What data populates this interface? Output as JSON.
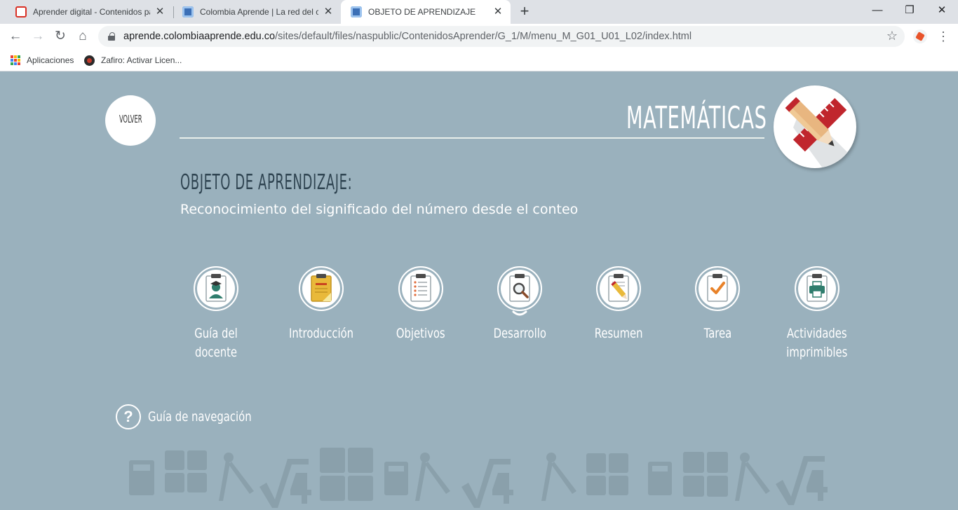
{
  "browser": {
    "tabs": [
      {
        "title": "Aprender digital - Contenidos pa",
        "active": false
      },
      {
        "title": "Colombia Aprende | La red del co",
        "active": false
      },
      {
        "title": "OBJETO DE APRENDIZAJE",
        "active": true
      }
    ],
    "new_tab_label": "+",
    "window_controls": {
      "minimize": "—",
      "restore": "❐",
      "close": "✕"
    },
    "url_host": "aprende.colombiaaprende.edu.co",
    "url_path": "/sites/default/files/naspublic/ContenidosAprender/G_1/M/menu_M_G01_U01_L02/index.html",
    "bookmarks": [
      {
        "label": "Aplicaciones",
        "icon": "apps-grid-icon"
      },
      {
        "label": "Zafiro: Activar Licen...",
        "icon": "zafiro-icon"
      }
    ]
  },
  "page": {
    "back_label": "VOLVER",
    "subject": "MATEMÁTICAS",
    "object_label": "OBJETO DE APRENDIZAJE:",
    "object_title": "Reconocimiento del significado del número desde el conteo",
    "menu": [
      {
        "label": "Guía del docente",
        "icon": "teacher-clipboard-icon"
      },
      {
        "label": "Introducción",
        "icon": "notebook-icon"
      },
      {
        "label": "Objetivos",
        "icon": "checklist-icon"
      },
      {
        "label": "Desarrollo",
        "icon": "magnifier-icon"
      },
      {
        "label": "Resumen",
        "icon": "pencil-notes-icon"
      },
      {
        "label": "Tarea",
        "icon": "checkmark-icon"
      },
      {
        "label": "Actividades\nimprimibles",
        "icon": "printer-icon"
      }
    ],
    "help_label": "Guía de navegación",
    "colors": {
      "background": "#9ab1bd",
      "title_dark": "#2f4451",
      "accent_red": "#c0262d"
    }
  }
}
